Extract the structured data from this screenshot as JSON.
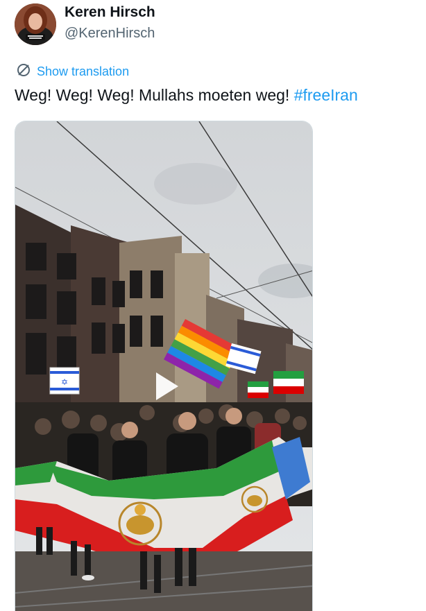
{
  "author": {
    "display_name": "Keren Hirsch",
    "handle": "@KerenHirsch",
    "avatar_icon": "profile-photo"
  },
  "translation": {
    "label": "Show translation",
    "icon": "globe-translate-icon",
    "color": "#1d9bf0"
  },
  "tweet": {
    "text": "Weg! Weg! Weg! Mullahs moeten weg! ",
    "hashtag": "#freeIran"
  },
  "media": {
    "type": "video",
    "play_icon": "play-icon"
  },
  "colors": {
    "text": "#0f1419",
    "secondary": "#536471",
    "accent": "#1d9bf0"
  }
}
